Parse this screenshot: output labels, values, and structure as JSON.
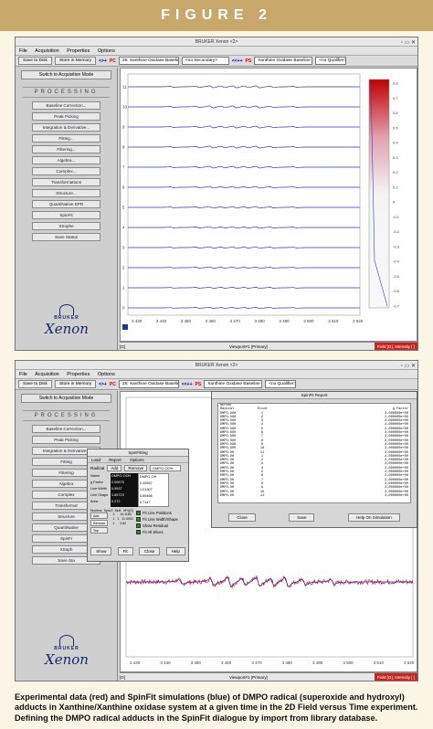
{
  "figure_label": "FIGURE 2",
  "window_title": "BRUKER Xenon <2>",
  "menu": [
    "File",
    "Acquisition",
    "Properties",
    "Options"
  ],
  "toolbar": {
    "save_disk": "Save to Disk",
    "store_memory": "Store in Memory",
    "top_dataset1": "25: Xanthine Oxidase Baseline C",
    "secondary": "<no Secondary>",
    "dataset2": "Xanthine Oxidase Baseline Cor",
    "qualifier": "<no Qualifier>",
    "pc_label": "PC",
    "ps_label": "PS",
    "nav": "<>+",
    "nav_dd": "<<++"
  },
  "sidebar": {
    "switch_mode": "Switch to Acquisition Mode",
    "processing": "PROCESSING",
    "items1": [
      "Baseline Correction...",
      "Peak Picking",
      "Integration & Derivative...",
      "Fitting...",
      "Filtering...",
      "Algebra...",
      "Complex...",
      "Transformations",
      "Structure...",
      "QuantiNative EPR",
      "SpinFit",
      "XSophe",
      "Save Status"
    ],
    "items2": [
      "Baseline Correction...",
      "Peak Picking",
      "Integration & Derivative...",
      "Fitting",
      "Filtering",
      "Algebra",
      "Complex",
      "Transformat",
      "Structure",
      "QuantiNative",
      "SpinFi",
      "XSoph",
      "Save Sta"
    ]
  },
  "brand": {
    "logo": "BRUKER",
    "product": "Xenon"
  },
  "plot1": {
    "x_ticks": [
      "3 430",
      "3 440",
      "3 450",
      "3 460",
      "3 470",
      "3 480",
      "3 490",
      "3 500",
      "3 510",
      "3 520"
    ],
    "y_ticks": [
      "11",
      "10",
      "9",
      "8",
      "7",
      "6",
      "5",
      "4",
      "3",
      "2",
      "1",
      "0"
    ],
    "colorbar_ticks": [
      "0.8",
      "0.7",
      "0.6",
      "0.5",
      "0.4",
      "0.3",
      "0.2",
      "0.1",
      "0",
      "-0.1",
      "-0.2",
      "-0.3",
      "-0.4",
      "-0.5",
      "-0.6",
      "-0.7"
    ],
    "viewport": "Viewport#1 (Primary)",
    "status_left": "[G]",
    "field": "Field [G], Intensity [ ]"
  },
  "plot2": {
    "x_ticks": [
      "3 430",
      "3 440",
      "3 450",
      "3 460",
      "3 470",
      "3 480",
      "3 490",
      "3 500",
      "3 510",
      "3 520"
    ],
    "viewport": "Viewport#1 (Primary)",
    "status_left": "[G]",
    "field": "Field [G], Intensity [ ]"
  },
  "report_dialog": {
    "title": "SpinFit Report",
    "header": "REPORT",
    "columns": [
      "Radical",
      "Slice",
      "g Factor"
    ],
    "rows": [
      [
        "DMPO-OOH",
        "1",
        "2,000000e+00"
      ],
      [
        "DMPO-OOH",
        "2",
        "2,000000e+00"
      ],
      [
        "DMPO-OOH",
        "3",
        "2,000000e+00"
      ],
      [
        "DMPO-OOH",
        "4",
        "2,000000e+00"
      ],
      [
        "DMPO-OOH",
        "5",
        "2,000000e+00"
      ],
      [
        "DMPO-OOH",
        "6",
        "2,000000e+00"
      ],
      [
        "DMPO-OOH",
        "7",
        "2,000000e+00"
      ],
      [
        "DMPO-OOH",
        "8",
        "2,000000e+00"
      ],
      [
        "DMPO-OOH",
        "9",
        "2,000000e+00"
      ],
      [
        "DMPO-OOH",
        "10",
        "2,000000e+00"
      ],
      [
        "DMPO-OH",
        "11",
        "2,000000e+00"
      ],
      [
        "DMPO-OH",
        "1",
        "2,000000e+00"
      ],
      [
        "DMPO-OH",
        "2",
        "2,000000e+00"
      ],
      [
        "DMPO-OH",
        "3",
        "2,000000e+00"
      ],
      [
        "DMPO-OH",
        "4",
        "2,000000e+00"
      ],
      [
        "DMPO-OH",
        "5",
        "2,000000e+00"
      ],
      [
        "DMPO-OH",
        "6",
        "2,000000e+00"
      ],
      [
        "DMPO-OH",
        "7",
        "2,000000e+00"
      ],
      [
        "DMPO-OH",
        "8",
        "2,000000e+00"
      ],
      [
        "DMPO-OH",
        "9",
        "2,000000e+00"
      ],
      [
        "DMPO-OH",
        "10",
        "2,000000e+00"
      ],
      [
        "DMPO-OH",
        "11",
        "2,000000e+00"
      ]
    ],
    "buttons": [
      "Close",
      "Save",
      "Help On Simulation"
    ]
  },
  "spinfit_dialog": {
    "title": "SpinFitting",
    "menu": [
      "Load",
      "Report",
      "Options"
    ],
    "radical_label": "Radical",
    "add_label": "Add",
    "remove_label": "Remove",
    "radical_value": "DMPO-OOH",
    "tabs": [
      "DMPO-OOH",
      "DMPO-OH"
    ],
    "param_labels": [
      "Name",
      "g Factor",
      "Line Width",
      "Line Shape",
      "Area"
    ],
    "col1": [
      "DMPO-OOH",
      "2.00675",
      "0.9537",
      "1.65723",
      "0.272"
    ],
    "col2": [
      "DMPO-OH",
      "2.00567",
      "1.01307",
      "0.89466",
      "0.7147"
    ],
    "nucleus_header": [
      "Nucleus",
      "Spin/2",
      "Mult.",
      "hFs[G]"
    ],
    "nucleus_rows": [
      [
        "",
        "1",
        "",
        "14.1183"
      ],
      [
        "",
        "1",
        "1",
        "11.3902"
      ],
      [
        "",
        "1",
        "",
        "0.82"
      ]
    ],
    "nucleus_buttons": [
      "Add",
      "Remove",
      "Top"
    ],
    "options": [
      "Fit Line Positions",
      "Fit Line Width/Shape",
      "Show Residual",
      "Fit All Slices"
    ],
    "buttons": [
      "Show",
      "Fit",
      "Close",
      "Help"
    ]
  },
  "caption": "Experimental data (red) and SpinFit simulations (blue) of DMPO radical (superoxide and hydroxyl) adducts in Xanthine/Xanthine oxidase system at a given time in the 2D Field versus Time experiment. Defining the DMPO radical adducts in the SpinFit dialogue by import from library database."
}
